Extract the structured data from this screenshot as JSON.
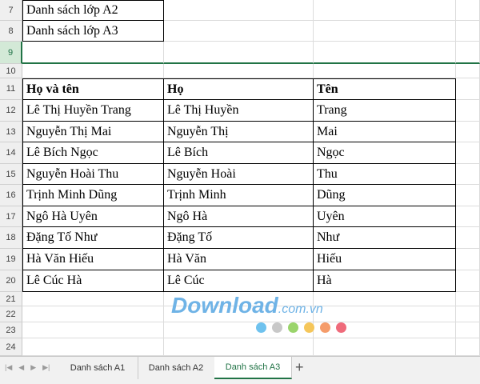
{
  "rows": [
    {
      "num": "7",
      "a": "Danh sách lớp A2",
      "b": "",
      "c": "",
      "style": "list"
    },
    {
      "num": "8",
      "a": "Danh sách lớp A3",
      "b": "",
      "c": "",
      "style": "list"
    },
    {
      "num": "9",
      "a": "",
      "b": "",
      "c": "",
      "style": "selected"
    },
    {
      "num": "10",
      "a": "",
      "b": "",
      "c": "",
      "style": "blank"
    },
    {
      "num": "11",
      "a": "Họ và tên",
      "b": "Họ",
      "c": "Tên",
      "style": "header"
    },
    {
      "num": "12",
      "a": "Lê Thị Huyền Trang",
      "b": "Lê Thị Huyền",
      "c": "Trang",
      "style": "table"
    },
    {
      "num": "13",
      "a": "Nguyễn Thị Mai",
      "b": "Nguyễn Thị",
      "c": "Mai",
      "style": "table"
    },
    {
      "num": "14",
      "a": "Lê Bích Ngọc",
      "b": "Lê Bích",
      "c": "Ngọc",
      "style": "table"
    },
    {
      "num": "15",
      "a": "Nguyễn Hoài Thu",
      "b": "Nguyễn Hoài",
      "c": "Thu",
      "style": "table"
    },
    {
      "num": "16",
      "a": "Trịnh Minh Dũng",
      "b": "Trịnh Minh",
      "c": "Dũng",
      "style": "table"
    },
    {
      "num": "17",
      "a": "Ngô Hà Uyên",
      "b": "Ngô Hà",
      "c": "Uyên",
      "style": "table"
    },
    {
      "num": "18",
      "a": "Đặng Tố Như",
      "b": "Đặng Tố",
      "c": "Như",
      "style": "table"
    },
    {
      "num": "19",
      "a": "Hà Văn Hiếu",
      "b": "Hà Văn",
      "c": "Hiếu",
      "style": "table"
    },
    {
      "num": "20",
      "a": "Lê Cúc Hà",
      "b": "Lê Cúc",
      "c": "Hà",
      "style": "table"
    },
    {
      "num": "21",
      "a": "",
      "b": "",
      "c": "",
      "style": "blank"
    },
    {
      "num": "22",
      "a": "",
      "b": "",
      "c": "",
      "style": "blank"
    },
    {
      "num": "23",
      "a": "",
      "b": "",
      "c": "",
      "style": "blank"
    },
    {
      "num": "24",
      "a": "",
      "b": "",
      "c": "",
      "style": "blank"
    }
  ],
  "watermark": {
    "main": "Download",
    "suffix": ".com.vn",
    "dot_colors": [
      "#6fc2ee",
      "#c8c8c8",
      "#9ad46b",
      "#f5c65a",
      "#f59c6a",
      "#ef6b7b"
    ]
  },
  "sheet_tabs": [
    {
      "label": "Danh sách A1",
      "active": false
    },
    {
      "label": "Danh sách A2",
      "active": false
    },
    {
      "label": "Danh sách A3",
      "active": true
    }
  ],
  "add_sheet_label": "+",
  "colors": {
    "accent": "#217346",
    "selected_header": "#d3e9d7"
  }
}
